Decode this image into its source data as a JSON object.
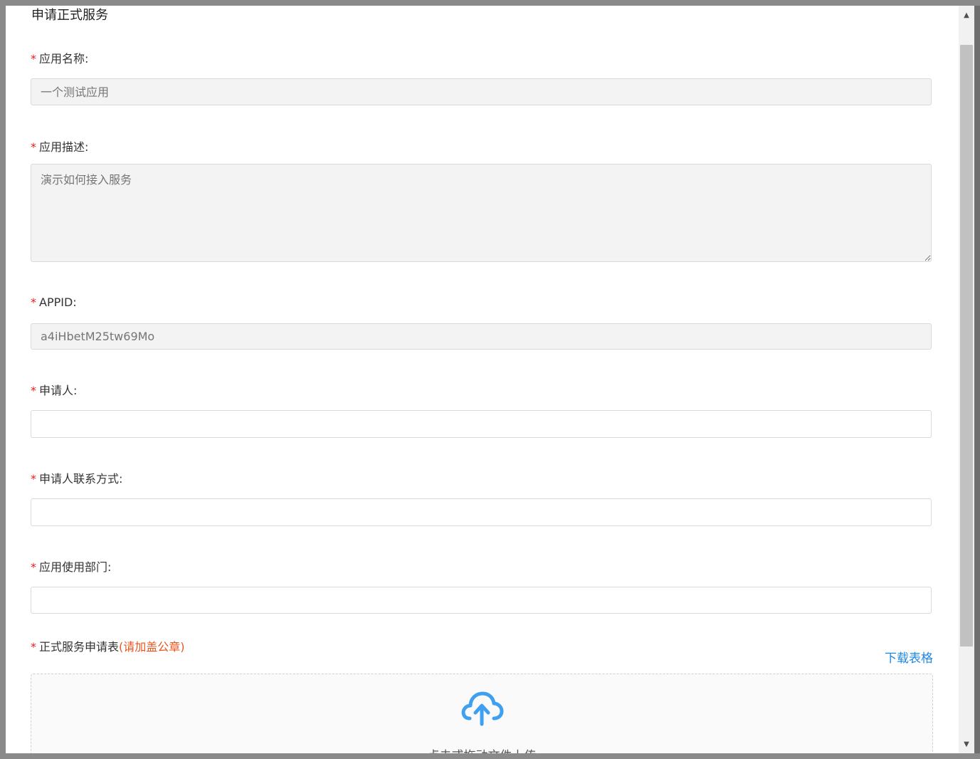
{
  "modal": {
    "title": "申请正式服务"
  },
  "form": {
    "required_mark": "*",
    "app_name": {
      "label": "应用名称:",
      "placeholder": "一个测试应用"
    },
    "app_desc": {
      "label": "应用描述:",
      "placeholder": "演示如何接入服务"
    },
    "appid": {
      "label": "APPID:",
      "placeholder": "a4iHbetM25tw69Mo"
    },
    "applicant": {
      "label": "申请人:",
      "value": ""
    },
    "applicant_contact": {
      "label": "申请人联系方式:",
      "value": ""
    },
    "department": {
      "label": "应用使用部门:",
      "value": ""
    },
    "application_form": {
      "label": "正式服务申请表",
      "note": "(请加盖公章)",
      "download_label": "下载表格",
      "upload_text": "点击或拖动文件上传"
    }
  },
  "icons": {
    "upload": "cloud-upload-icon",
    "scroll_up": "triangle-up-icon",
    "scroll_down": "triangle-down-icon"
  },
  "colors": {
    "accent": "#1e88e5",
    "required": "#e02020",
    "note": "#e8541f",
    "upload_icon": "#3ea0f0"
  }
}
